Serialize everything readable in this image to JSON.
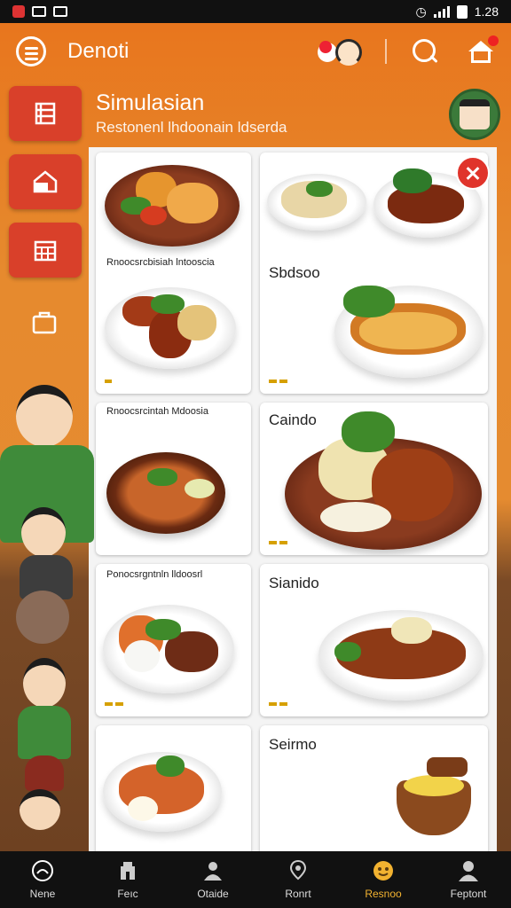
{
  "status_bar": {
    "time": "1.28"
  },
  "app_bar": {
    "title": "Denoti"
  },
  "header": {
    "restaurant_name": "Simulasian",
    "subtitle": "Restonenl lhdoonain ldserda"
  },
  "menu": {
    "cards": [
      {
        "label": "Rnoocsrcbisiah lntooscia",
        "title": ""
      },
      {
        "label": "",
        "title": "Sbdsoo"
      },
      {
        "label": "Rnoocsrcintah Mdoosia",
        "title": ""
      },
      {
        "label": "",
        "title": "Caindo"
      },
      {
        "label": "Ponocsrgntnln lldoosrl",
        "title": ""
      },
      {
        "label": "",
        "title": "Sianido"
      },
      {
        "label": "",
        "title": ""
      },
      {
        "label": "",
        "title": "Seirmo"
      }
    ]
  },
  "bottom_nav": {
    "items": [
      {
        "label": "Nene",
        "icon": "home-circle-icon"
      },
      {
        "label": "Feıc",
        "icon": "store-icon"
      },
      {
        "label": "Otaide",
        "icon": "person-icon"
      },
      {
        "label": "Ronrt",
        "icon": "location-pin-icon"
      },
      {
        "label": "Resnoo",
        "icon": "mascot-icon",
        "active": true
      },
      {
        "label": "Feptont",
        "icon": "profile-icon"
      }
    ]
  },
  "colors": {
    "accent": "#e8741c",
    "rail_red": "#d9402a",
    "active_nav": "#f2b230",
    "close_red": "#e0342b"
  }
}
